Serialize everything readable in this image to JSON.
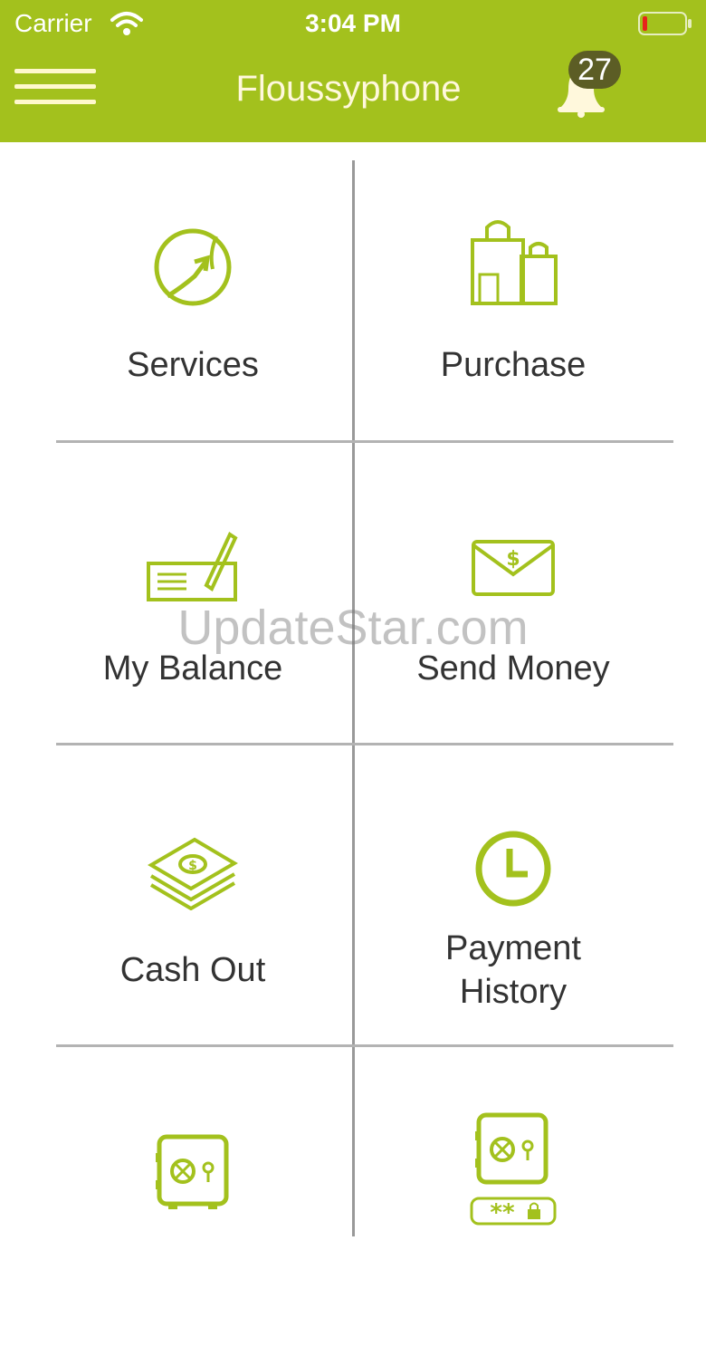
{
  "status_bar": {
    "carrier": "Carrier",
    "time": "3:04 PM",
    "icons": [
      "wifi-icon",
      "battery-icon"
    ]
  },
  "header": {
    "title": "Floussyphone",
    "notification_count": "27",
    "icons": [
      "menu-icon",
      "bell-icon"
    ]
  },
  "menu": {
    "items": [
      {
        "label": "Services",
        "icon": "services-icon"
      },
      {
        "label": "Purchase",
        "icon": "shopping-bags-icon"
      },
      {
        "label": "My Balance",
        "icon": "check-pen-icon"
      },
      {
        "label": "Send Money",
        "icon": "money-envelope-icon"
      },
      {
        "label": "Cash Out",
        "icon": "cash-stack-icon"
      },
      {
        "label": "Payment",
        "label2": "History",
        "icon": "clock-icon"
      },
      {
        "label": "",
        "icon": "safe-icon"
      },
      {
        "label": "",
        "icon": "safe-password-icon"
      }
    ]
  },
  "watermark": "UpdateStar.com",
  "colors": {
    "brand": "#a3c11d",
    "icon": "#a3c11d",
    "text": "#333333",
    "badge": "#5c5d25"
  }
}
